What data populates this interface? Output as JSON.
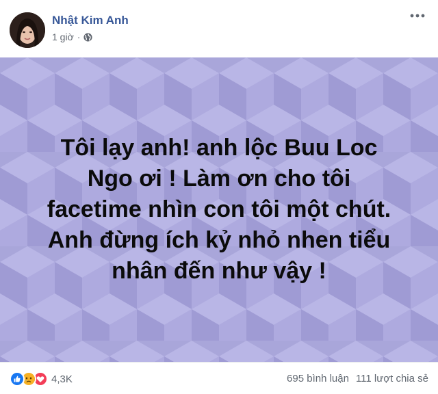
{
  "post": {
    "author": "Nhật Kim Anh",
    "time": "1 giờ",
    "separator": "·",
    "privacy_icon": "globe-icon",
    "more_icon": "more-options-icon",
    "text": "Tôi lạy anh! anh lộc Buu Loc Ngo ơi ! Làm ơn cho tôi facetime nhìn con tôi một chút. Anh đừng ích kỷ nhỏ nhen tiểu nhân đến như vậy !",
    "text_lines": [
      "Tôi lạy anh! anh lộc Buu Loc",
      "Ngo ơi ! Làm ơn cho tôi",
      "facetime nhìn con tôi một chút.",
      "Anh đừng ích kỷ nhỏ nhen tiểu",
      "nhân đến như vậy !"
    ],
    "background_color": "#a9a6da",
    "text_color": "#0b0b0b"
  },
  "footer": {
    "reaction_icons": [
      "like-icon",
      "sad-icon",
      "love-icon"
    ],
    "reaction_count": "4,3K",
    "comments": "695 bình luận",
    "shares": "111 lượt chia sẻ"
  },
  "colors": {
    "author": "#385898",
    "like": "#1877f2",
    "love": "#f33e58",
    "sad": "#f7b125"
  }
}
